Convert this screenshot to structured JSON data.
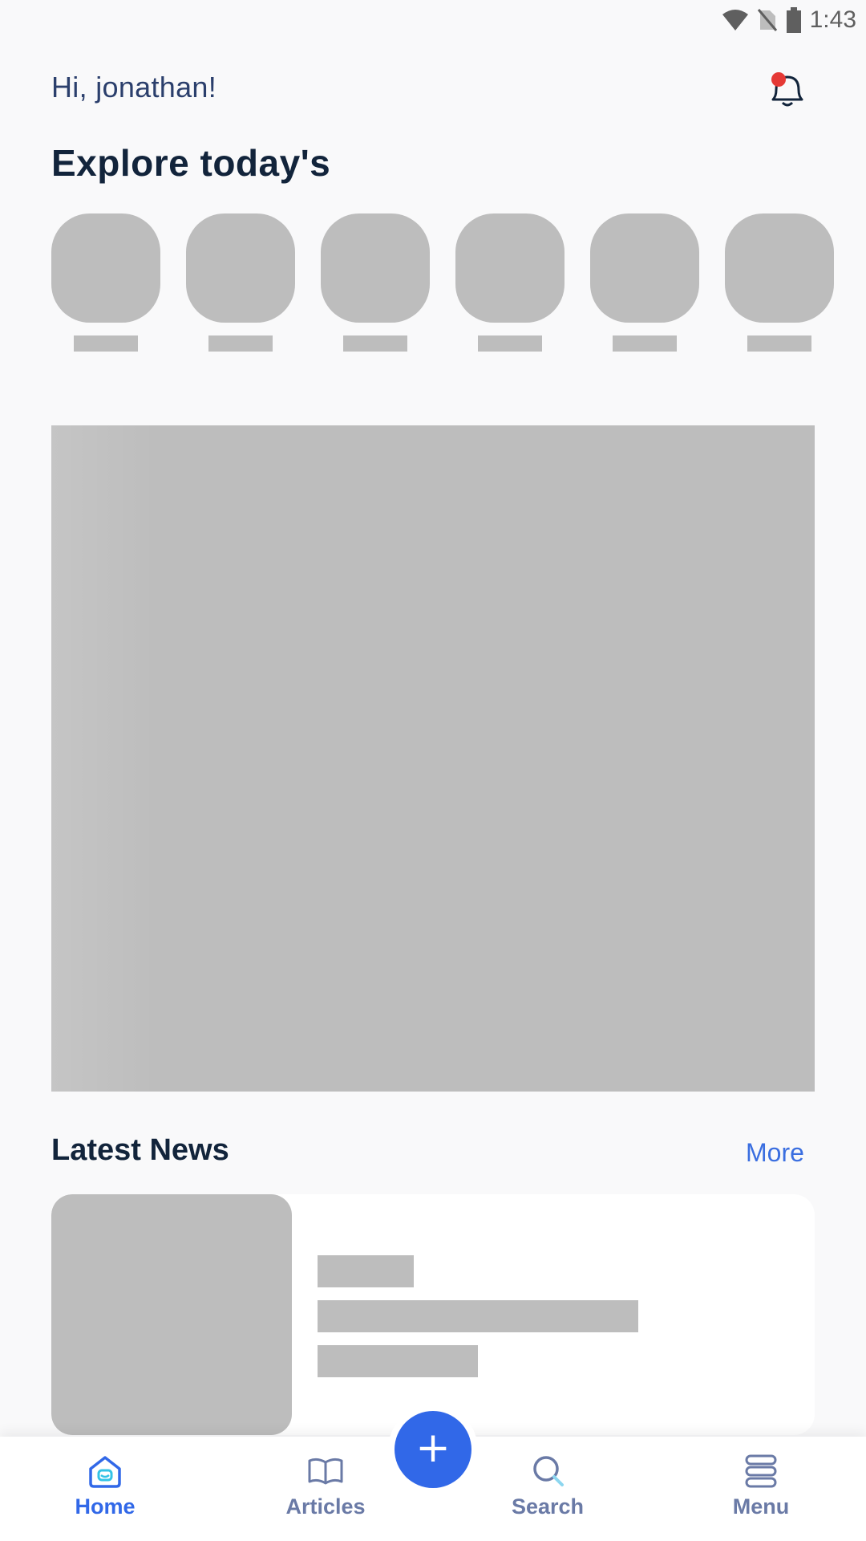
{
  "status_bar": {
    "time": "1:43",
    "icons": [
      "wifi-icon",
      "no-sim-icon",
      "battery-icon"
    ]
  },
  "header": {
    "greeting": "Hi, jonathan!",
    "notification_icon": "bell-icon",
    "has_unread_notifications": true,
    "notification_dot_color": "#e53935"
  },
  "explore": {
    "title": "Explore today's",
    "stories": [
      "",
      "",
      "",
      "",
      "",
      ""
    ]
  },
  "latest_news": {
    "title": "Latest News",
    "more_label": "More"
  },
  "bottom_nav": {
    "items": [
      {
        "label": "Home",
        "icon": "home-icon",
        "active": true
      },
      {
        "label": "Articles",
        "icon": "book-icon",
        "active": false
      },
      {
        "label": "Search",
        "icon": "search-icon",
        "active": false
      },
      {
        "label": "Menu",
        "icon": "menu-icon",
        "active": false
      }
    ],
    "fab_label": "+",
    "fab_icon": "plus-icon"
  },
  "colors": {
    "accent": "#3168e8",
    "heading": "#12243b",
    "greeting": "#2b3f6c",
    "skeleton": "#bdbdbd",
    "nav_label": "#6a7aa6"
  }
}
